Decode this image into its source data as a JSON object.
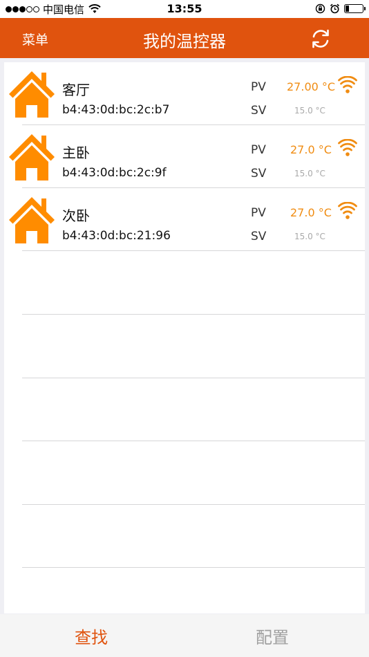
{
  "status_bar": {
    "signal_dots_filled": 3,
    "signal_dots_total": 5,
    "carrier": "中国电信",
    "time": "13:55",
    "battery_level": 0.2,
    "icons": [
      "wifi-icon",
      "orientation-lock-icon",
      "alarm-icon",
      "battery-icon"
    ]
  },
  "nav": {
    "menu_label": "菜单",
    "title": "我的温控器",
    "refresh_icon": "refresh-icon"
  },
  "colors": {
    "brand": "#e0530e",
    "house": "#ff8c00",
    "pv_text": "#f08c12",
    "sv_text": "#a9a9a9",
    "tab_active": "#e0530e",
    "tab_inactive": "#a0a0a0"
  },
  "devices": [
    {
      "name": "客厅",
      "mac": "b4:43:0d:bc:2c:b7",
      "pv_label": "PV",
      "pv_value": "27.00 °C",
      "sv_label": "SV",
      "sv_value": "15.0 °C"
    },
    {
      "name": "主卧",
      "mac": "b4:43:0d:bc:2c:9f",
      "pv_label": "PV",
      "pv_value": "27.0 °C",
      "sv_label": "SV",
      "sv_value": "15.0 °C"
    },
    {
      "name": "次卧",
      "mac": "b4:43:0d:bc:21:96",
      "pv_label": "PV",
      "pv_value": "27.0 °C",
      "sv_label": "SV",
      "sv_value": "15.0 °C"
    }
  ],
  "tabs": [
    {
      "label": "查找",
      "active": true
    },
    {
      "label": "配置",
      "active": false
    }
  ]
}
